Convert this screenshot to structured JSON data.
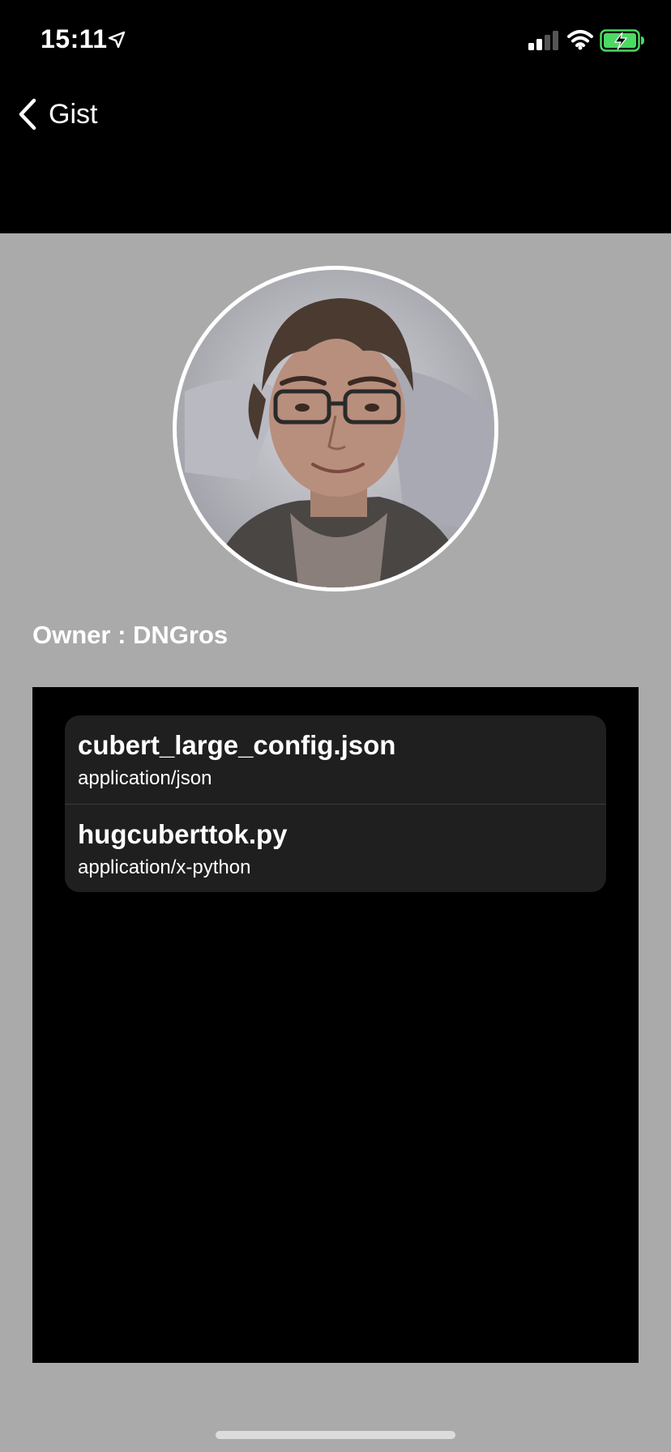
{
  "status_bar": {
    "time": "15:11",
    "icons": [
      "location-arrow-icon",
      "cellular-signal-icon",
      "wifi-icon",
      "battery-charging-icon"
    ],
    "battery_color": "#4cd964"
  },
  "nav": {
    "back_label": "Gist",
    "back_icon": "chevron-left-icon"
  },
  "owner": {
    "text": "Owner : DNGros"
  },
  "files": [
    {
      "name": "cubert_large_config.json",
      "type": "application/json"
    },
    {
      "name": "hugcuberttok.py",
      "type": "application/x-python"
    }
  ],
  "colors": {
    "background": "#aaaaaa",
    "panel": "#000000",
    "list_row": "#1f1f1f",
    "text": "#ffffff"
  }
}
